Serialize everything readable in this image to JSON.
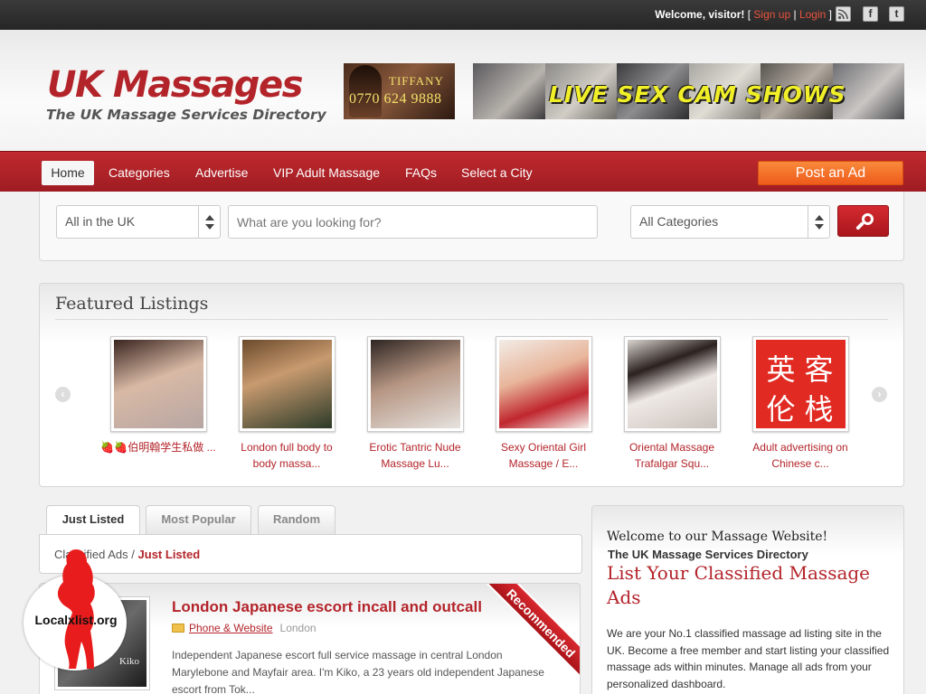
{
  "topbar": {
    "welcome_prefix": "Welcome, visitor!",
    "bracket_open": "[",
    "signup": "Sign up",
    "separator": "|",
    "login": "Login",
    "bracket_close": "]",
    "icons": [
      "rss-icon",
      "facebook-icon",
      "twitter-icon"
    ],
    "facebook_glyph": "f",
    "twitter_glyph": "t"
  },
  "header": {
    "logo_title": "UK Massages",
    "logo_tagline": "The UK Massage Services Directory",
    "banner1": {
      "name": "TIFFANY",
      "phone": "0770 624 9888"
    },
    "banner2": {
      "text": "LIVE SEX CAM SHOWS"
    }
  },
  "nav": {
    "items": [
      "Home",
      "Categories",
      "Advertise",
      "VIP Adult Massage",
      "FAQs",
      "Select a City"
    ],
    "post_button": "Post an Ad"
  },
  "search": {
    "location": "All in the UK",
    "placeholder": "What are you looking for?",
    "category": "All Categories"
  },
  "featured": {
    "title": "Featured Listings",
    "items": [
      {
        "caption": "🍓🍓伯明翰学生私做 ..."
      },
      {
        "caption": "London full body to body massa..."
      },
      {
        "caption": "Erotic Tantric Nude Massage Lu..."
      },
      {
        "caption": "Sexy Oriental Girl Massage / E..."
      },
      {
        "caption": "Oriental Massage Trafalgar Squ..."
      },
      {
        "caption": "Adult advertising on Chinese c..."
      }
    ],
    "chinese_logo_chars": [
      "英",
      "客",
      "伦",
      "栈"
    ]
  },
  "tabs": [
    "Just Listed",
    "Most Popular",
    "Random"
  ],
  "breadcrumb": {
    "root": "Classified Ads",
    "sep": "/",
    "current": "Just Listed"
  },
  "listing": {
    "title": "London Japanese escort incall and outcall",
    "category": "Phone & Website",
    "location": "London",
    "description": "Independent Japanese escort full service massage in central London Marylebone and Mayfair area. I'm Kiko, a 23 years old independent Japanese escort from Tok...",
    "ribbon": "Recommended",
    "thumb_label": "Kiko"
  },
  "sidebar": {
    "welcome": "Welcome to our Massage Website!",
    "subtitle": "The UK Massage Services Directory",
    "headline": "List Your Classified Massage Ads",
    "body": "We are your No.1 classified massage ad listing site in the UK. Become a free member and start listing your classified massage ads within minutes. Manage all ads from your personalized dashboard."
  },
  "watermark": {
    "text": "Localxlist.org"
  },
  "colors": {
    "brand_red": "#b3242a",
    "nav_red": "#b32329",
    "post_orange": "#f47a2e",
    "topbar": "#2f2f2f"
  }
}
